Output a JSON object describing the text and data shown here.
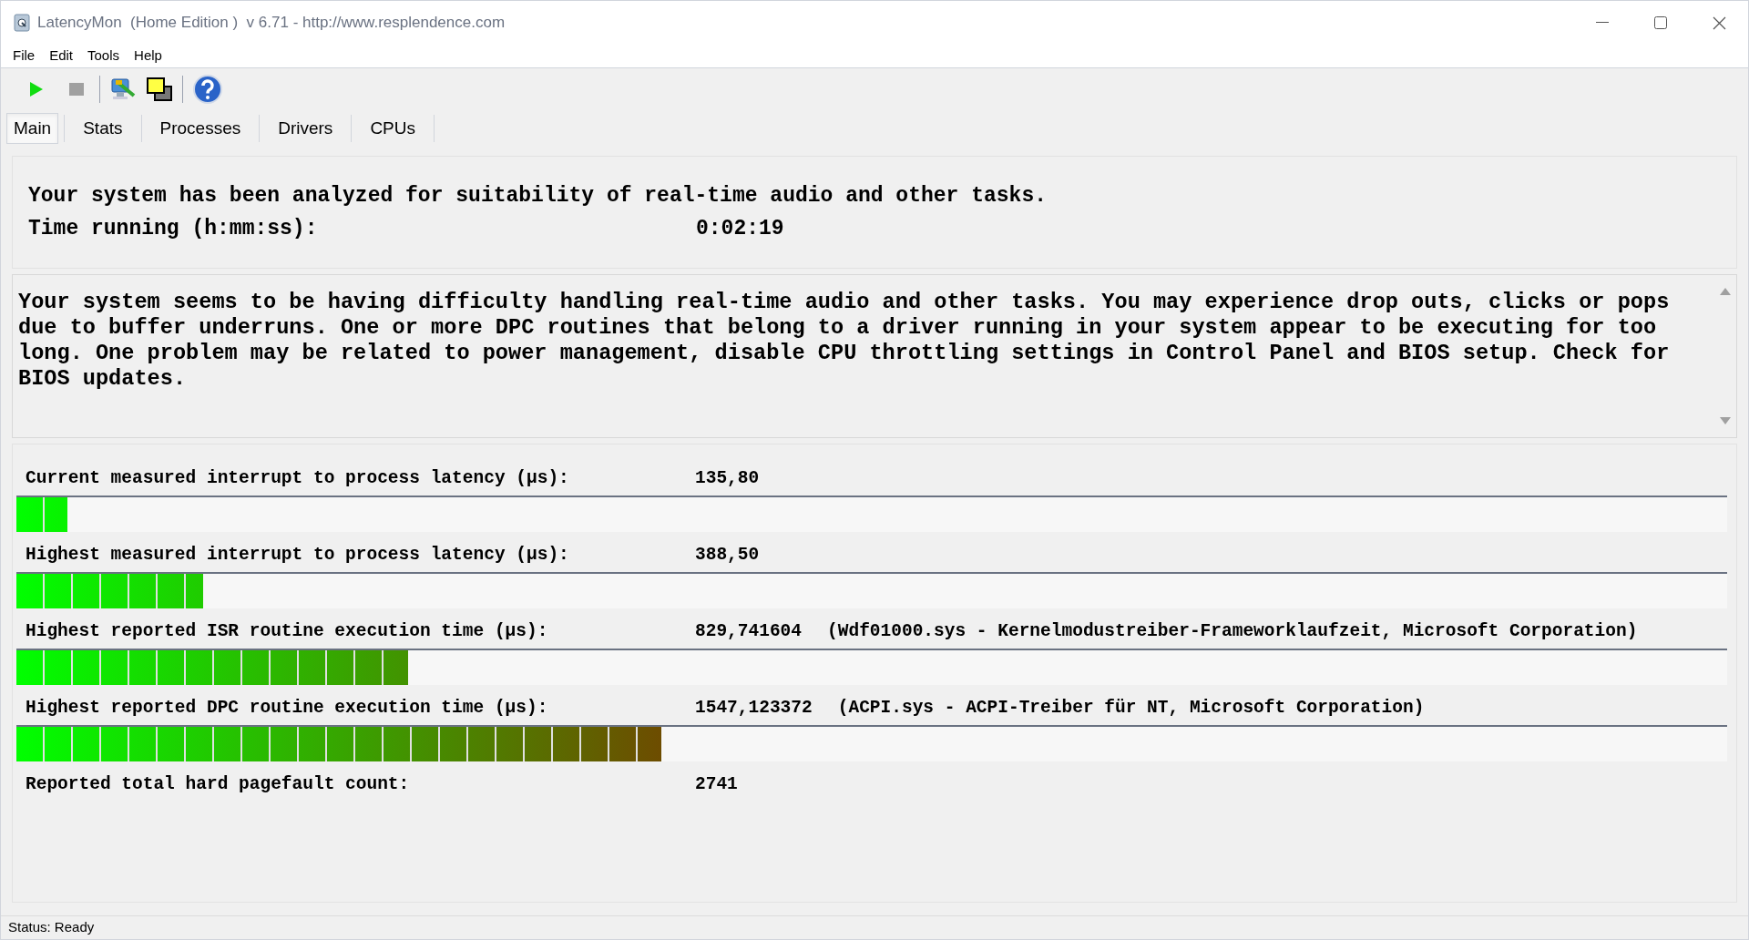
{
  "window": {
    "title": "LatencyMon  (Home Edition )  v 6.71 - http://www.resplendence.com"
  },
  "menu": [
    "File",
    "Edit",
    "Tools",
    "Help"
  ],
  "tabs": [
    {
      "label": "Main",
      "selected": true
    },
    {
      "label": "Stats",
      "selected": false
    },
    {
      "label": "Processes",
      "selected": false
    },
    {
      "label": "Drivers",
      "selected": false
    },
    {
      "label": "CPUs",
      "selected": false
    }
  ],
  "summary": {
    "headline": "Your system has been analyzed for suitability of real-time audio and other tasks.",
    "time_label": "Time running (h:mm:ss):",
    "time_value": "0:02:19"
  },
  "verdict": "Your system seems to be having difficulty handling real-time audio and other tasks. You may experience drop outs, clicks or pops due to buffer underruns. One or more DPC routines that belong to a driver running in your system appear to be executing for too long. One problem may be related to power management, disable CPU throttling settings in Control Panel and BIOS setup. Check for BIOS updates.",
  "measurements": [
    {
      "label": "Current measured interrupt to process latency (µs):",
      "value": "135,80",
      "level": 0.03
    },
    {
      "label": "Highest measured interrupt to process latency (µs):",
      "value": "388,50",
      "level": 0.109
    },
    {
      "label": "Highest reported ISR routine execution time (µs):",
      "value": "829,741604",
      "detail": "(Wdf01000.sys - Kernelmodustreiber-Frameworklaufzeit, Microsoft Corporation)",
      "level": 0.229
    },
    {
      "label": "Highest reported DPC routine execution time (µs):",
      "value": "1547,123372",
      "detail": "(ACPI.sys - ACPI-Treiber für NT, Microsoft Corporation)",
      "level": 0.377
    },
    {
      "label": "Reported total hard pagefault count:",
      "value": "2741"
    }
  ],
  "status_bar": "Status: Ready"
}
